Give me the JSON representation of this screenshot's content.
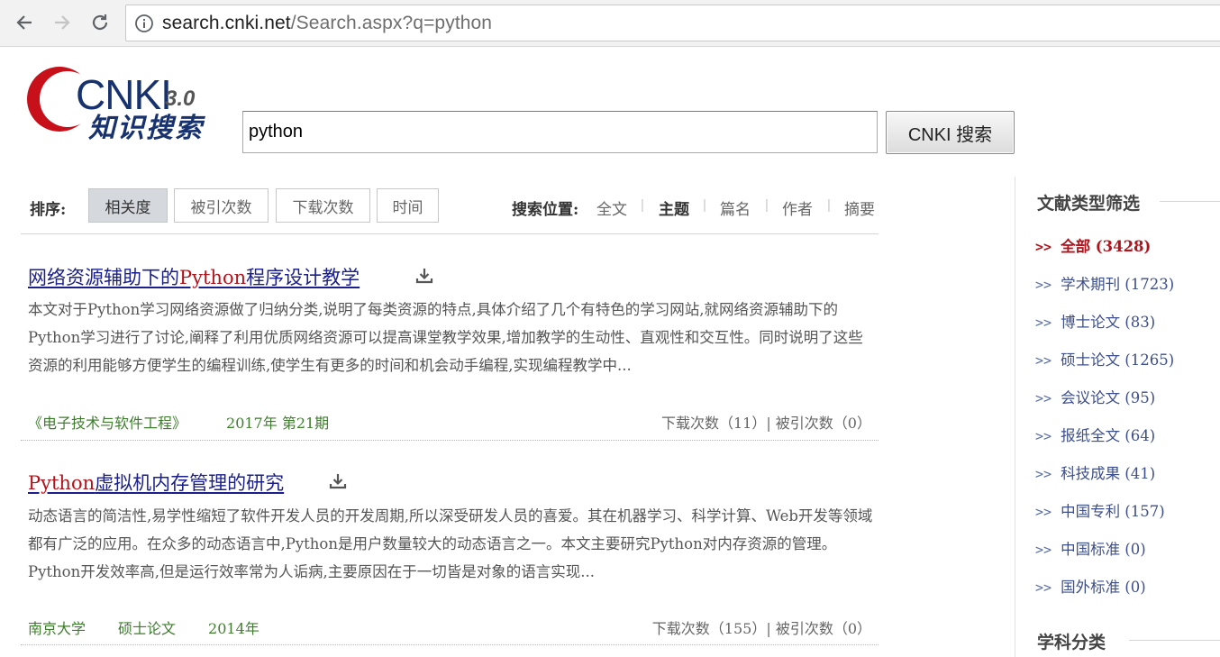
{
  "browser": {
    "url_host": "search.cnki.net",
    "url_path": "/Search.aspx?q=python"
  },
  "logo": {
    "text": "CNKI",
    "version": "3.0",
    "subtitle": "知识搜索"
  },
  "search": {
    "query": "python",
    "button_label": "CNKI 搜索"
  },
  "sort": {
    "label": "排序:",
    "options": [
      "相关度",
      "被引次数",
      "下载次数",
      "时间"
    ],
    "active": "相关度"
  },
  "position": {
    "label": "搜索位置:",
    "options": [
      "全文",
      "主题",
      "篇名",
      "作者",
      "摘要"
    ],
    "active": "主题"
  },
  "results": [
    {
      "title_pre": "网络资源辅助下的",
      "title_hl": "Python",
      "title_post": "程序设计教学",
      "abstract": "本文对于Python学习网络资源做了归纳分类,说明了每类资源的特点,具体介绍了几个有特色的学习网站,就网络资源辅助下的Python学习进行了讨论,阐释了利用优质网络资源可以提高课堂教学效果,增加教学的生动性、直观性和交互性。同时说明了这些资源的利用能够方便学生的编程训练,使学生有更多的时间和机会动手编程,实现编程教学中...",
      "meta": [
        "《电子技术与软件工程》",
        "2017年 第21期"
      ],
      "stats": "下载次数（11）| 被引次数（0）"
    },
    {
      "title_pre": "",
      "title_hl": "Python",
      "title_post": "虚拟机内存管理的研究",
      "abstract": "动态语言的简洁性,易学性缩短了软件开发人员的开发周期,所以深受研发人员的喜爱。其在机器学习、科学计算、Web开发等领域都有广泛的应用。在众多的动态语言中,Python是用户数量较大的动态语言之一。本文主要研究Python对内存资源的管理。Python开发效率高,但是运行效率常为人诟病,主要原因在于一切皆是对象的语言实现...",
      "meta": [
        "南京大学",
        "硕士论文",
        "2014年"
      ],
      "stats": "下载次数（155）| 被引次数（0）"
    }
  ],
  "sidebar": {
    "doc_type_heading": "文献类型筛选",
    "items": [
      {
        "label": "全部 (3428)",
        "active": true
      },
      {
        "label": "学术期刊 (1723)",
        "active": false
      },
      {
        "label": "博士论文 (83)",
        "active": false
      },
      {
        "label": "硕士论文 (1265)",
        "active": false
      },
      {
        "label": "会议论文 (95)",
        "active": false
      },
      {
        "label": "报纸全文 (64)",
        "active": false
      },
      {
        "label": "科技成果 (41)",
        "active": false
      },
      {
        "label": "中国专利 (157)",
        "active": false
      },
      {
        "label": "中国标准 (0)",
        "active": false
      },
      {
        "label": "国外标准 (0)",
        "active": false
      }
    ],
    "subject_heading": "学科分类",
    "arrow": ">>"
  },
  "colors": {
    "link_blue": "#1a1f8c",
    "highlight_red": "#b0131b",
    "meta_green": "#3f7d2e",
    "sidebar_blue": "#3d4f8c"
  }
}
